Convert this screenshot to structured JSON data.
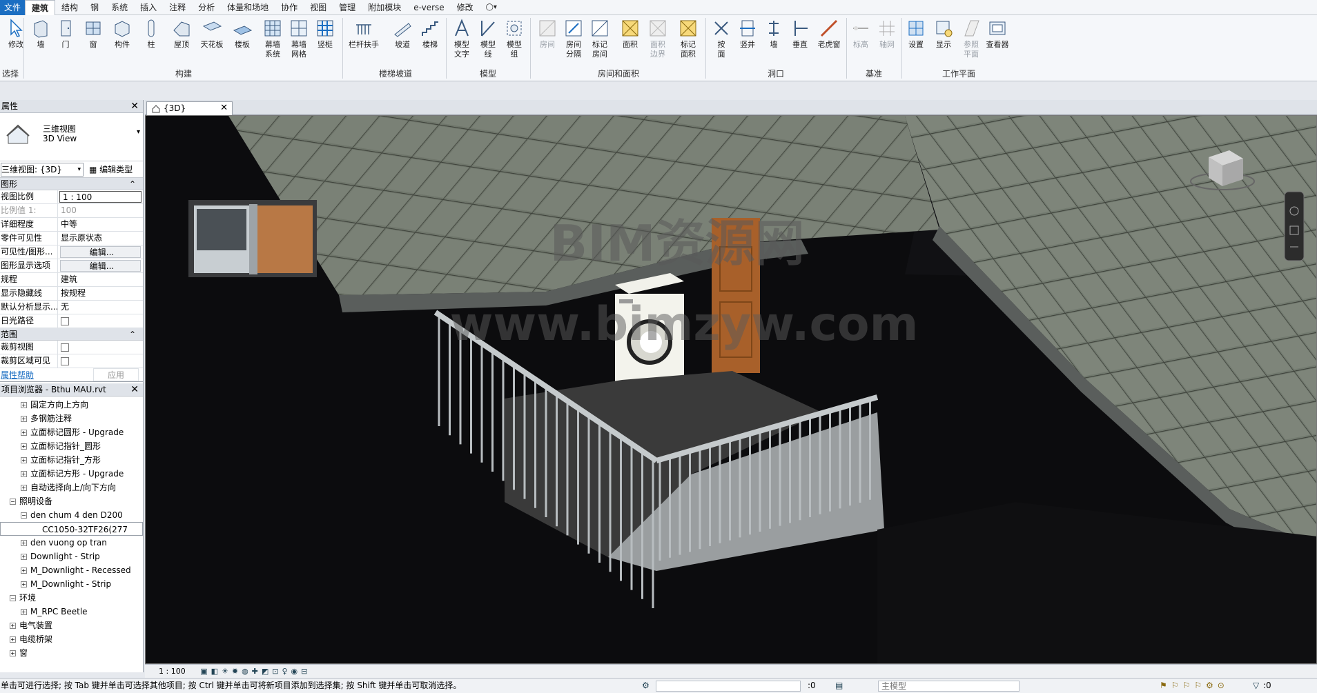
{
  "ribbon_tabs": [
    "文件",
    "建筑",
    "结构",
    "钢",
    "系统",
    "插入",
    "注释",
    "分析",
    "体量和场地",
    "协作",
    "视图",
    "管理",
    "附加模块",
    "e-verse",
    "修改"
  ],
  "tools": {
    "modify": "修改",
    "select": "选择",
    "wall": "墙",
    "door": "门",
    "window": "窗",
    "component": "构件",
    "column": "柱",
    "roof": "屋顶",
    "ceiling": "天花板",
    "floor": "楼板",
    "curtain_system": "幕墙\n系统",
    "curtain_grid": "幕墙\n网格",
    "mullion": "竖梃",
    "railing": "栏杆扶手",
    "ramp": "坡道",
    "stair": "楼梯",
    "model_text": "模型\n文字",
    "model_line": "模型\n线",
    "model_group": "模型\n组",
    "room": "房间",
    "room_separator": "房间\n分隔",
    "tag_room": "标记\n房间",
    "area": "面积",
    "area_boundary": "面积\n边界",
    "tag_area": "标记\n面积",
    "by_face": "按\n面",
    "shaft": "竖井",
    "wall_opening": "墙",
    "vertical": "垂直",
    "dormer": "老虎窗",
    "level": "标高",
    "grid": "轴网",
    "set": "设置",
    "show": "显示",
    "ref_plane": "参照\n平面",
    "viewer": "查看器"
  },
  "panels": {
    "build": "构建",
    "circulation": "楼梯坡道",
    "model": "模型",
    "room_area": "房间和面积",
    "opening": "洞口",
    "datum": "基准",
    "work_plane": "工作平面"
  },
  "properties": {
    "title": "属性",
    "type_name_cn": "三维视图",
    "type_name_en": "3D View",
    "view_selector": "三维视图: {3D}",
    "edit_type": "编辑类型",
    "group_graphics": "图形",
    "rows": [
      {
        "k": "视图比例",
        "v": "1 : 100"
      },
      {
        "k": "比例值 1:",
        "v": "100"
      },
      {
        "k": "详细程度",
        "v": "中等"
      },
      {
        "k": "零件可见性",
        "v": "显示原状态"
      },
      {
        "k": "可见性/图形...",
        "v": "编辑..."
      },
      {
        "k": "图形显示选项",
        "v": "编辑..."
      },
      {
        "k": "规程",
        "v": "建筑"
      },
      {
        "k": "显示隐藏线",
        "v": "按规程"
      },
      {
        "k": "默认分析显示...",
        "v": "无"
      },
      {
        "k": "日光路径",
        "v": ""
      }
    ],
    "group_extents": "范围",
    "rows2": [
      {
        "k": "裁剪视图",
        "v": ""
      },
      {
        "k": "裁剪区域可见",
        "v": ""
      }
    ],
    "help_link": "属性帮助",
    "apply": "应用"
  },
  "browser": {
    "title": "项目浏览器 - Bthu MAU.rvt",
    "items": [
      "固定方向上方向",
      "多钢筋注释",
      "立面标记圆形 - Upgrade",
      "立面标记指针_圆形",
      "立面标记指针_方形",
      "立面标记方形 - Upgrade",
      "自动选择向上/向下方向",
      "照明设备",
      "den chum 4 den D200",
      "CC1050-32TF26(277",
      "den vuong op tran",
      "Downlight - Strip",
      "M_Downlight - Recessed",
      "M_Downlight - Strip",
      "环境",
      "M_RPC Beetle",
      "电气装置",
      "电缆桥架",
      "窗"
    ]
  },
  "view": {
    "tab_label": "{3D}",
    "watermark1": "BIM资源网",
    "watermark2": "www.bimzyw.com",
    "scale": "1 : 100"
  },
  "status": {
    "message": "单击可进行选择; 按 Tab 键并单击可选择其他项目; 按 Ctrl 键并单击可将新项目添加到选择集; 按 Shift 键并单击可取消选择。",
    "zero1": ":0",
    "model": "主模型",
    "filter": ":0"
  },
  "colors": {
    "accent": "#1b6ec2",
    "roof": "#6e7468",
    "door": "#b06a2a"
  }
}
